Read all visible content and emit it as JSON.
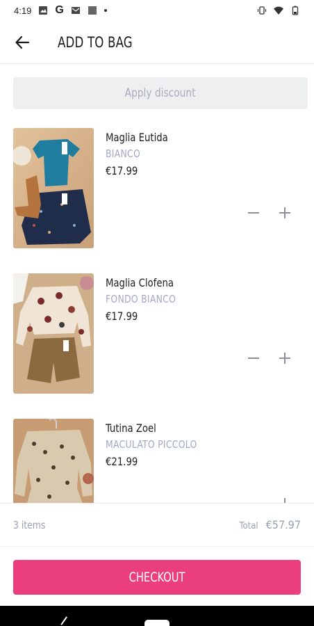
{
  "status_bar": {
    "time": "4:19",
    "icons": [
      "image-icon",
      "google-icon",
      "mail-icon",
      "square-icon",
      "dot-icon",
      "vibrate-icon",
      "wifi-icon",
      "battery-icon"
    ]
  },
  "header": {
    "title": "ADD TO BAG",
    "back_icon": "arrow-left-icon"
  },
  "discount": {
    "label": "Apply discount"
  },
  "items": [
    {
      "name": "Maglia Eutida",
      "variant": "BIANCO",
      "price": "€17.99"
    },
    {
      "name": "Maglia Clofena",
      "variant": "FONDO BIANCO",
      "price": "€17.99"
    },
    {
      "name": "Tutina Zoel",
      "variant": "MACULATO PICCOLO",
      "price": "€21.99"
    }
  ],
  "summary": {
    "count": "3 items",
    "total_label": "Total",
    "total_value": "€57.97"
  },
  "checkout": {
    "label": "CHECKOUT"
  },
  "colors": {
    "accent": "#ea3f7c",
    "variant_text": "#a2a7c9",
    "discount_bg": "#eeeff1"
  }
}
